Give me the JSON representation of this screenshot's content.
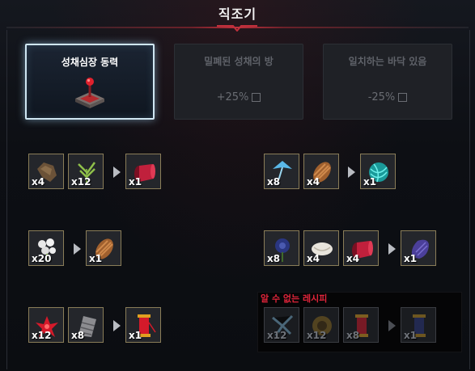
{
  "window": {
    "title": "직조기"
  },
  "tabs": [
    {
      "label": "성채심장 동력",
      "bonus": "",
      "active": true,
      "icon": "altar-lever-icon"
    },
    {
      "label": "밀폐된 성채의 방",
      "bonus": "+25%",
      "active": false,
      "icon": "hourglass-icon"
    },
    {
      "label": "일치하는 바닥 있음",
      "bonus": "-25%",
      "active": false,
      "icon": "coin-stack-icon"
    }
  ],
  "recipes": [
    {
      "inputs": [
        {
          "icon": "hide-scrap-icon",
          "qty": "x4"
        },
        {
          "icon": "herb-sprig-icon",
          "qty": "x12"
        }
      ],
      "output": {
        "icon": "red-cloth-bolt-icon",
        "qty": "x1"
      }
    },
    {
      "inputs": [
        {
          "icon": "blue-flower-icon",
          "qty": "x8"
        },
        {
          "icon": "rope-coil-icon",
          "qty": "x4"
        }
      ],
      "output": {
        "icon": "cyan-yarn-ball-icon",
        "qty": "x1"
      }
    },
    {
      "inputs": [
        {
          "icon": "white-flower-icon",
          "qty": "x20"
        }
      ],
      "output": {
        "icon": "rope-coil-icon",
        "qty": "x1"
      }
    },
    {
      "inputs": [
        {
          "icon": "dark-blue-flower-icon",
          "qty": "x8"
        },
        {
          "icon": "silk-cocoon-icon",
          "qty": "x4"
        },
        {
          "icon": "red-cloth-bolt-icon",
          "qty": "x4"
        }
      ],
      "output": {
        "icon": "purple-cloth-sack-icon",
        "qty": "x1"
      }
    },
    {
      "inputs": [
        {
          "icon": "red-flower-icon",
          "qty": "x12"
        },
        {
          "icon": "metal-mesh-icon",
          "qty": "x8"
        }
      ],
      "output": {
        "icon": "red-thread-spool-icon",
        "qty": "x1"
      }
    }
  ],
  "unknown_recipe": {
    "label": "알 수 없는 레시피",
    "inputs": [
      {
        "icon": "blue-leaf-icon",
        "qty": "x12"
      },
      {
        "icon": "sunflower-icon",
        "qty": "x12"
      },
      {
        "icon": "red-thread-spool-icon",
        "qty": "x8"
      }
    ],
    "output": {
      "icon": "blue-thread-spool-icon",
      "qty": "x1"
    }
  }
}
